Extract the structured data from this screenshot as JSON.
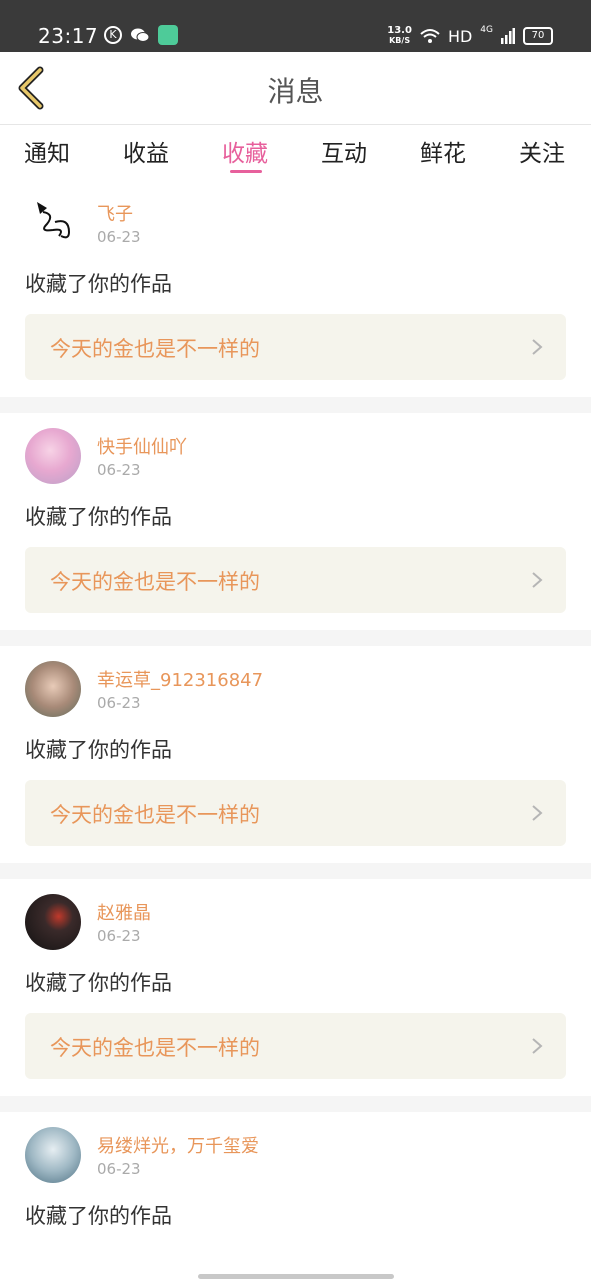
{
  "status_bar": {
    "time": "23:17",
    "speed_value": "13.0",
    "speed_unit": "KB/S",
    "hd": "HD",
    "network": "4G",
    "battery": "70"
  },
  "header": {
    "back_icon": "chevron-left-icon",
    "title": "消息"
  },
  "tabs": [
    {
      "label": "通知",
      "active": false
    },
    {
      "label": "收益",
      "active": false
    },
    {
      "label": "收藏",
      "active": true
    },
    {
      "label": "互动",
      "active": false
    },
    {
      "label": "鲜花",
      "active": false
    },
    {
      "label": "关注",
      "active": false
    }
  ],
  "accent_color": "#e7609c",
  "name_color": "#e8965a",
  "items": [
    {
      "username": "飞子",
      "date": "06-23",
      "action": "收藏了你的作品",
      "work_title": "今天的金也是不一样的"
    },
    {
      "username": "快手仙仙吖",
      "date": "06-23",
      "action": "收藏了你的作品",
      "work_title": "今天的金也是不一样的"
    },
    {
      "username": "幸运草_912316847",
      "date": "06-23",
      "action": "收藏了你的作品",
      "work_title": "今天的金也是不一样的"
    },
    {
      "username": "赵雅晶",
      "date": "06-23",
      "action": "收藏了你的作品",
      "work_title": "今天的金也是不一样的"
    },
    {
      "username": "易缕烊光，万千玺爱",
      "date": "06-23",
      "action": "收藏了你的作品",
      "work_title": ""
    }
  ]
}
